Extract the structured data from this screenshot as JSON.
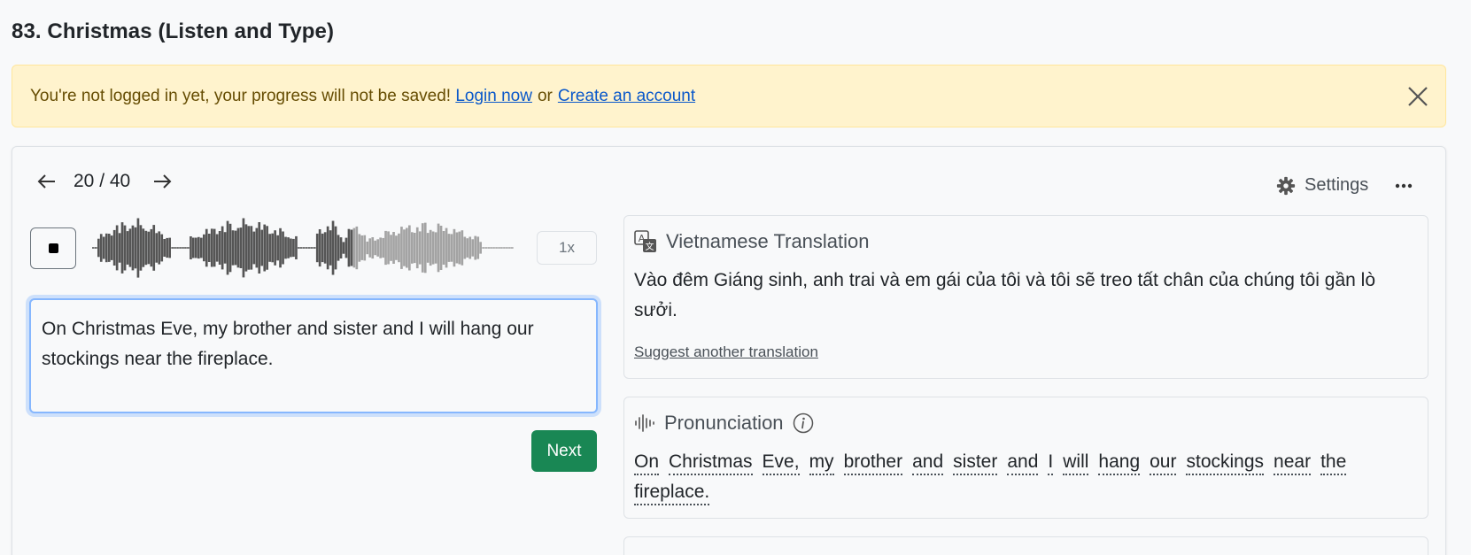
{
  "page": {
    "title": "83. Christmas (Listen and Type)"
  },
  "alert": {
    "message": "You're not logged in yet, your progress will not be saved!",
    "login_link": "Login now",
    "or_text": "or",
    "signup_link": "Create an account",
    "background": "#fff3cd"
  },
  "player": {
    "counter": "20 / 40",
    "settings_label": "Settings",
    "speed_label": "1x",
    "played_color": "#555555",
    "unplayed_color": "#a3a3a3"
  },
  "answer": {
    "value": "On Christmas Eve, my brother and sister and I will hang our stockings near the fireplace."
  },
  "next_label": "Next",
  "translation": {
    "title": "Vietnamese Translation",
    "text": "Vào đêm Giáng sinh, anh trai và em gái của tôi và tôi sẽ treo tất chân của chúng tôi gần lò sưởi.",
    "suggest_link": "Suggest another translation"
  },
  "pronunciation": {
    "title": "Pronunciation",
    "words": [
      "On",
      "Christmas",
      "Eve,",
      "my",
      "brother",
      "and",
      "sister",
      "and",
      "I",
      "will",
      "hang",
      "our",
      "stockings",
      "near",
      "the",
      "fireplace."
    ]
  },
  "colors": {
    "accent_green": "#198754",
    "focus_blue": "#86b7fe",
    "link_blue": "#0a58ca"
  }
}
